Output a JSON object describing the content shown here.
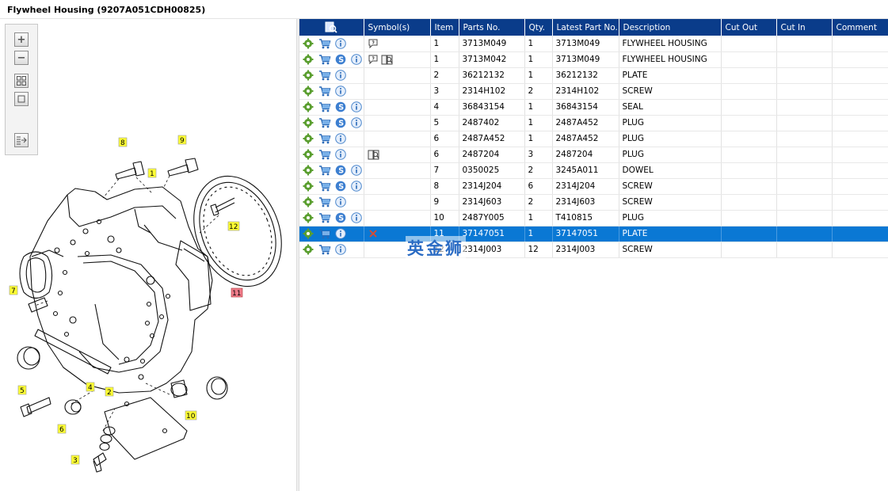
{
  "window": {
    "title": "Flywheel Housing (9207A051CDH00825)"
  },
  "toolbox": {
    "tools": [
      "zoom-in-icon",
      "zoom-out-icon",
      "fit-all-icon",
      "fit-page-icon",
      "export-icon"
    ]
  },
  "diagram": {
    "callouts": [
      {
        "label": "8"
      },
      {
        "label": "9"
      },
      {
        "label": "1"
      },
      {
        "label": "12"
      },
      {
        "label": "11",
        "highlighted": true
      },
      {
        "label": "7"
      },
      {
        "label": "5"
      },
      {
        "label": "4"
      },
      {
        "label": "2"
      },
      {
        "label": "6"
      },
      {
        "label": "10"
      },
      {
        "label": "3"
      }
    ]
  },
  "table": {
    "columns": [
      "",
      "Symbol(s)",
      "Item",
      "Parts No.",
      "Qty.",
      "Latest Part No.",
      "Description",
      "Cut Out",
      "Cut In",
      "Comment"
    ],
    "rows": [
      {
        "item": "1",
        "part": "3713M049",
        "qty": "1",
        "latest": "3713M049",
        "desc": "FLYWHEEL HOUSING",
        "s": false,
        "sym": "note"
      },
      {
        "item": "1",
        "part": "3713M042",
        "qty": "1",
        "latest": "3713M049",
        "desc": "FLYWHEEL HOUSING",
        "s": true,
        "sym": "note-book"
      },
      {
        "item": "2",
        "part": "36212132",
        "qty": "1",
        "latest": "36212132",
        "desc": "PLATE",
        "s": false,
        "sym": ""
      },
      {
        "item": "3",
        "part": "2314H102",
        "qty": "2",
        "latest": "2314H102",
        "desc": "SCREW",
        "s": false,
        "sym": ""
      },
      {
        "item": "4",
        "part": "36843154",
        "qty": "1",
        "latest": "36843154",
        "desc": "SEAL",
        "s": true,
        "sym": ""
      },
      {
        "item": "5",
        "part": "2487402",
        "qty": "1",
        "latest": "2487A452",
        "desc": "PLUG",
        "s": true,
        "sym": ""
      },
      {
        "item": "6",
        "part": "2487A452",
        "qty": "1",
        "latest": "2487A452",
        "desc": "PLUG",
        "s": false,
        "sym": ""
      },
      {
        "item": "6",
        "part": "2487204",
        "qty": "3",
        "latest": "2487204",
        "desc": "PLUG",
        "s": false,
        "sym": "book"
      },
      {
        "item": "7",
        "part": "0350025",
        "qty": "2",
        "latest": "3245A011",
        "desc": "DOWEL",
        "s": true,
        "sym": ""
      },
      {
        "item": "8",
        "part": "2314J204",
        "qty": "6",
        "latest": "2314J204",
        "desc": "SCREW",
        "s": true,
        "sym": ""
      },
      {
        "item": "9",
        "part": "2314J603",
        "qty": "2",
        "latest": "2314J603",
        "desc": "SCREW",
        "s": false,
        "sym": ""
      },
      {
        "item": "10",
        "part": "2487Y005",
        "qty": "1",
        "latest": "T410815",
        "desc": "PLUG",
        "s": true,
        "sym": ""
      },
      {
        "item": "11",
        "part": "37147051",
        "qty": "1",
        "latest": "37147051",
        "desc": "PLATE",
        "s": false,
        "sym": "cross",
        "selected": true
      },
      {
        "item": "12",
        "part": "2314J003",
        "qty": "12",
        "latest": "2314J003",
        "desc": "SCREW",
        "s": false,
        "sym": ""
      }
    ]
  },
  "watermark": "英金狮",
  "colors": {
    "header_bg": "#0a3c8a",
    "selected_row": "#0a78d4",
    "callout": "#ffff33",
    "callout_highlight": "#f07c8a"
  }
}
